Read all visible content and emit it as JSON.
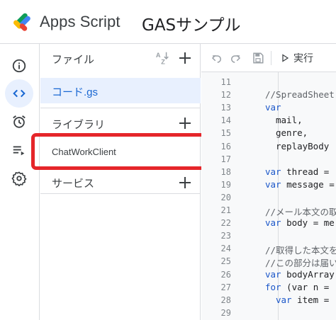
{
  "header": {
    "app_name": "Apps Script",
    "project_name": "GASサンプル"
  },
  "rail": {
    "items": [
      {
        "name": "overview-icon"
      },
      {
        "name": "editor-icon"
      },
      {
        "name": "triggers-icon"
      },
      {
        "name": "executions-icon"
      },
      {
        "name": "settings-icon"
      }
    ]
  },
  "panel": {
    "files_title": "ファイル",
    "file_item": "コード.gs",
    "libraries_title": "ライブラリ",
    "library_item": "ChatWorkClient",
    "services_title": "サービス"
  },
  "toolbar": {
    "run_label": "実行"
  },
  "editor": {
    "lines": [
      {
        "n": "11",
        "t": "",
        "c": "tx",
        "i": 0
      },
      {
        "n": "12",
        "t": "//SpreadSheet",
        "c": "cm",
        "i": 0
      },
      {
        "n": "13",
        "t": "var",
        "c": "kw",
        "i": 0
      },
      {
        "n": "14",
        "t": "mail,",
        "c": "tx",
        "i": 1
      },
      {
        "n": "15",
        "t": "genre,",
        "c": "tx",
        "i": 1
      },
      {
        "n": "16",
        "t": "replayBody",
        "c": "tx",
        "i": 1
      },
      {
        "n": "17",
        "t": "",
        "c": "tx",
        "i": 0
      },
      {
        "n": "18",
        "t": "var thread =",
        "c": "mix",
        "i": 0
      },
      {
        "n": "19",
        "t": "var message =",
        "c": "mix",
        "i": 0
      },
      {
        "n": "20",
        "t": "",
        "c": "tx",
        "i": 0
      },
      {
        "n": "21",
        "t": "//メール本文の取",
        "c": "cm",
        "i": 0
      },
      {
        "n": "22",
        "t": "var body = me",
        "c": "mix",
        "i": 0
      },
      {
        "n": "23",
        "t": "",
        "c": "tx",
        "i": 0
      },
      {
        "n": "24",
        "t": "//取得した本文を",
        "c": "cm",
        "i": 0
      },
      {
        "n": "25",
        "t": "//この部分は届い",
        "c": "cm",
        "i": 0
      },
      {
        "n": "26",
        "t": "var bodyArray",
        "c": "mix",
        "i": 0
      },
      {
        "n": "27",
        "t": "for (var n =",
        "c": "mix",
        "i": 0
      },
      {
        "n": "28",
        "t": "var item =",
        "c": "mix",
        "i": 1
      },
      {
        "n": "29",
        "t": "",
        "c": "tx",
        "i": 0
      }
    ]
  },
  "colors": {
    "accent": "#1967d2",
    "selected_bg": "#e8f0fe",
    "highlight_border": "#e5262a",
    "keyword": "#1a56c9"
  }
}
